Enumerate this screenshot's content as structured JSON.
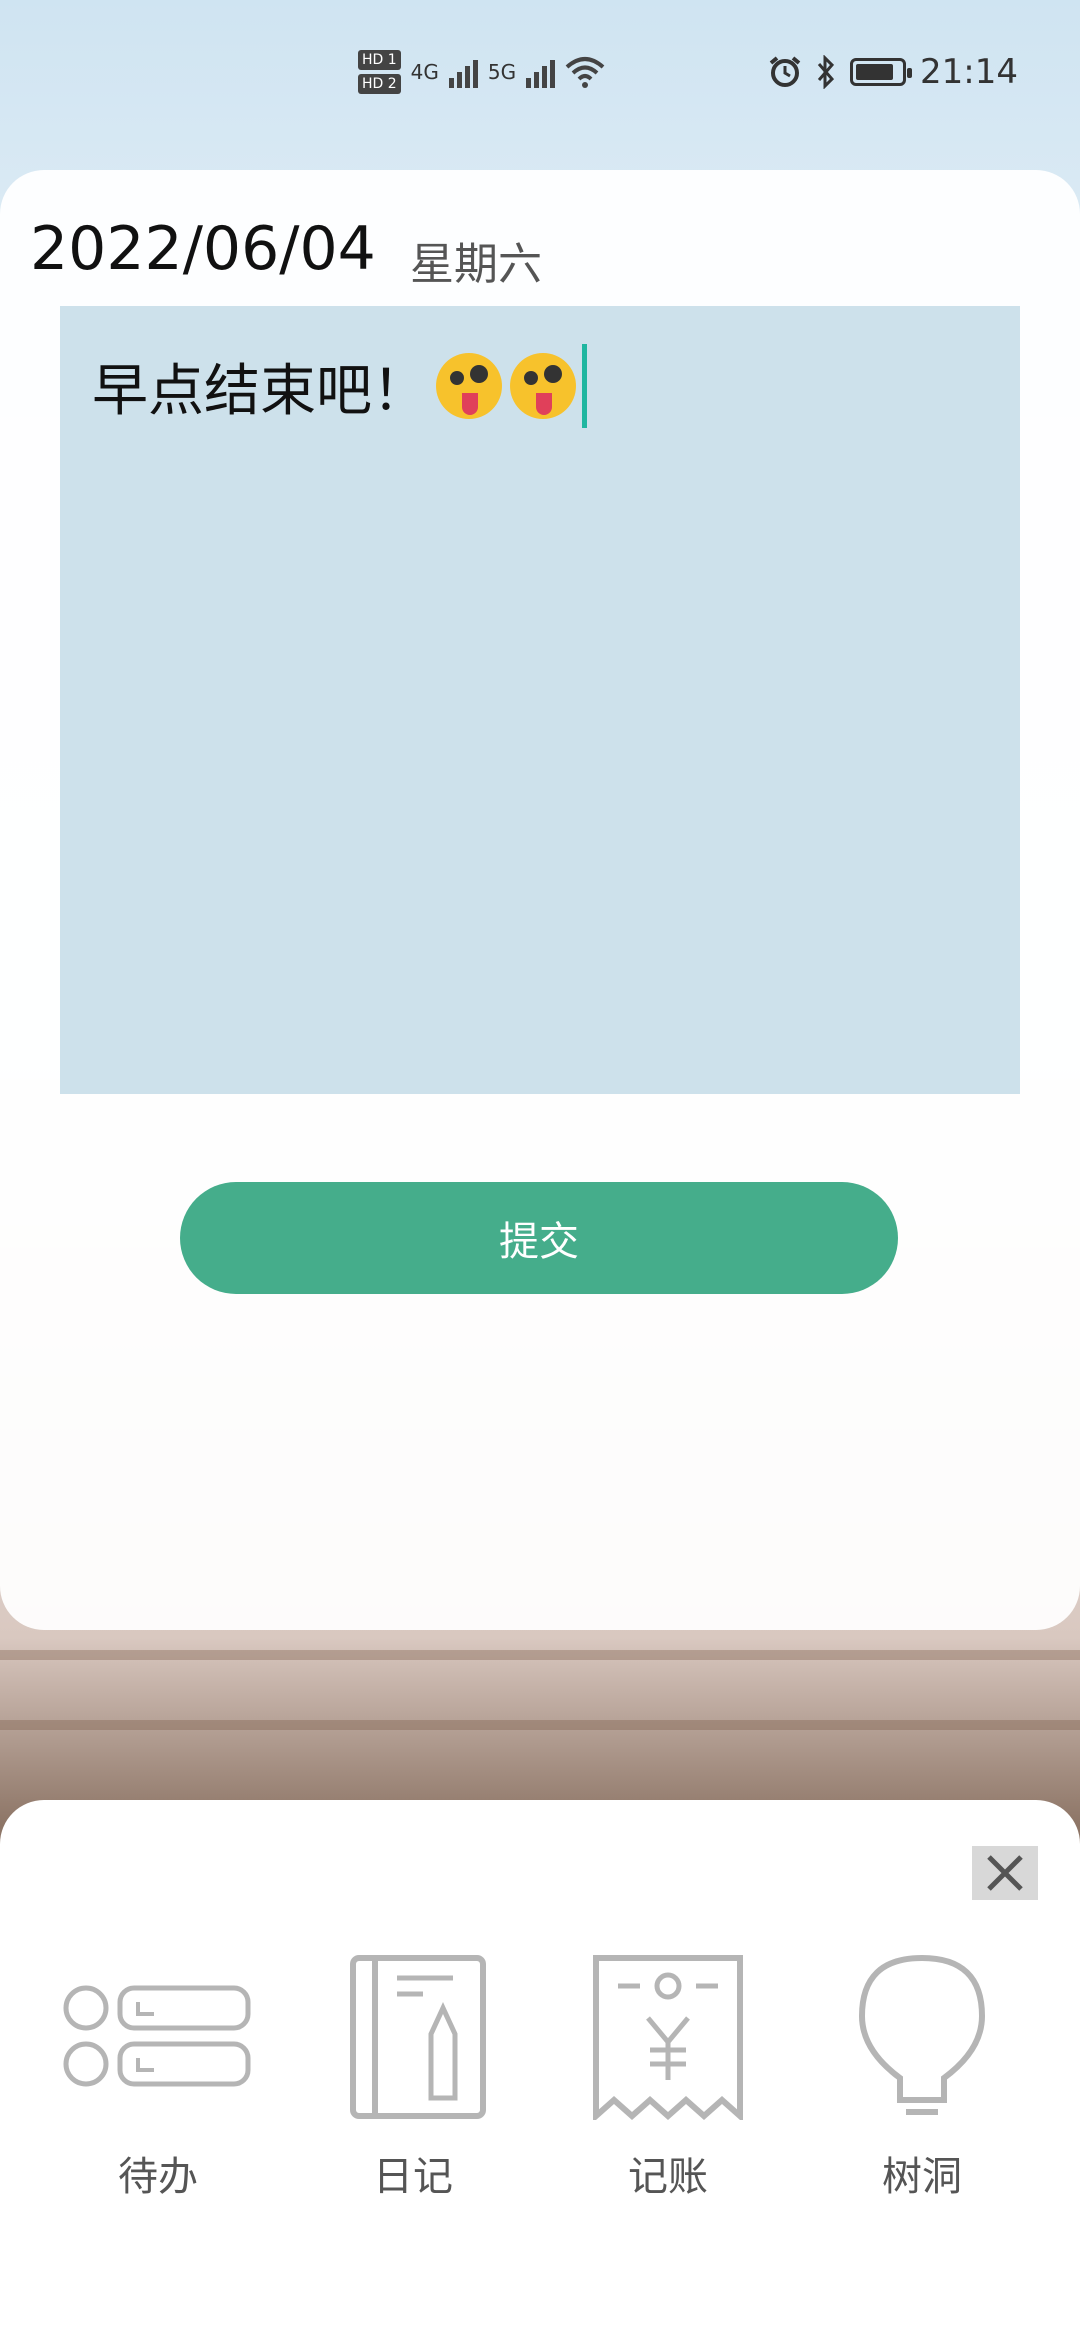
{
  "status_bar": {
    "hd1": "HD 1",
    "hd2": "HD 2",
    "net1": "4G",
    "net2": "5G",
    "time": "21:14",
    "battery_level": 0.85
  },
  "entry": {
    "date": "2022/06/04",
    "weekday": "星期六",
    "text": "早点结束吧！",
    "emoji_count": 2
  },
  "submit_label": "提交",
  "bottom_nav": {
    "items": [
      {
        "label": "待办",
        "icon": "todo-list-icon"
      },
      {
        "label": "日记",
        "icon": "diary-notebook-icon"
      },
      {
        "label": "记账",
        "icon": "receipt-yen-icon"
      },
      {
        "label": "树洞",
        "icon": "lightbulb-icon"
      }
    ]
  },
  "colors": {
    "accent": "#45ad8b",
    "editor_bg": "#c4dce8",
    "cursor": "#1fb6a0"
  }
}
